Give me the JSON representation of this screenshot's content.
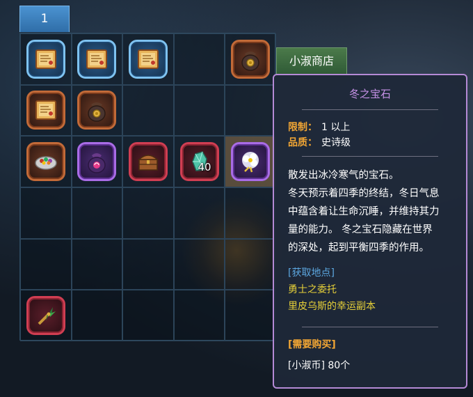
{
  "tab": {
    "label": "1"
  },
  "inventory": {
    "rows": [
      [
        {
          "icon": "scroll-map-icon",
          "frame": "blue",
          "qty": ""
        },
        {
          "icon": "scroll-map-icon",
          "frame": "blue",
          "qty": ""
        },
        {
          "icon": "scroll-map-icon",
          "frame": "blue",
          "qty": ""
        },
        null,
        {
          "icon": "coin-pouch-icon",
          "frame": "bronze",
          "qty": ""
        }
      ],
      [
        {
          "icon": "scroll-map-icon",
          "frame": "bronze",
          "qty": ""
        },
        {
          "icon": "coin-pouch-icon",
          "frame": "bronze",
          "qty": ""
        },
        null,
        null,
        null
      ],
      [
        {
          "icon": "food-bowl-icon",
          "frame": "bronze",
          "qty": ""
        },
        {
          "icon": "magic-pouch-icon",
          "frame": "purple",
          "qty": ""
        },
        {
          "icon": "treasure-chest-icon",
          "frame": "red",
          "qty": ""
        },
        {
          "icon": "winter-gem-icon",
          "frame": "red",
          "qty": "40"
        },
        {
          "icon": "flower-icon",
          "frame": "purple",
          "qty": "",
          "highlight": true
        }
      ],
      [
        null,
        null,
        null,
        null,
        null
      ],
      [
        null,
        null,
        null,
        null,
        null
      ],
      [
        {
          "icon": "windmill-staff-icon",
          "frame": "red",
          "qty": ""
        },
        null,
        null,
        null,
        null
      ]
    ]
  },
  "shop_button": {
    "label": "小淑商店"
  },
  "tooltip": {
    "title": "冬之宝石",
    "limit_label": "限制：",
    "limit_value": "1 以上",
    "quality_label": "品质：",
    "quality_value": "史诗级",
    "description": [
      "散发出冰冷寒气的宝石。",
      "冬天预示着四季的终结，冬日气息",
      "中蕴含着让生命沉睡，并维持其力",
      "量的能力。 冬之宝石隐藏在世界",
      "的深处，起到平衡四季的作用。"
    ],
    "obtain_header": "[获取地点]",
    "obtain_locations": [
      "勇士之委托",
      "里皮乌斯的幸运副本"
    ],
    "buy_header": "[需要购买]",
    "buy_value": "[小淑币] 80个"
  },
  "colors": {
    "tooltip_border": "#b58ad6",
    "title": "#c792e8",
    "stat_label": "#f2a634",
    "obtain_header": "#5ca7e0",
    "obtain_item": "#e5cf38"
  }
}
